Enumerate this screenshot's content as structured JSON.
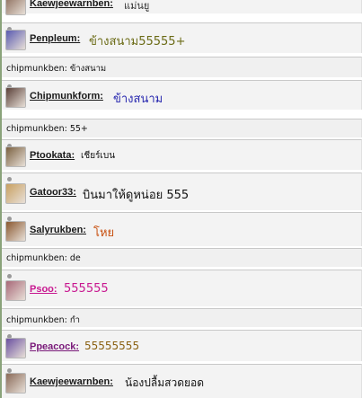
{
  "messages": [
    {
      "kind": "user",
      "user": "Kaewjeewarnben:",
      "text": "แม่นยู",
      "text_color": "#333333",
      "name_color": "#1a1a1a",
      "avatar": "photo-avatar-icon",
      "avatar_color": "#8a6a58"
    },
    {
      "kind": "user",
      "user": "Penpleum:",
      "text": "ข้างสนาม55555+",
      "text_color": "#6b6b16",
      "name_color": "#1a1a1a",
      "avatar": "cartoon-avatar-icon",
      "avatar_color": "#5a5ab0"
    },
    {
      "kind": "system",
      "text": "chipmunkben: ข้างสนาม"
    },
    {
      "kind": "user",
      "user": "Chipmunkform:",
      "text": "ข้างสนาม",
      "text_color": "#2a2ab0",
      "name_color": "#1a1a1a",
      "avatar": "photo-avatar-icon",
      "avatar_color": "#5a4038"
    },
    {
      "kind": "system",
      "text": "chipmunkben: 55+"
    },
    {
      "kind": "user",
      "user": "Ptookata:",
      "text": "เชียร์เบน",
      "text_color": "#111111",
      "name_color": "#1a1a1a",
      "avatar": "photo-avatar-icon",
      "avatar_color": "#7a6040"
    },
    {
      "kind": "user",
      "user": "Gatoor33:",
      "text": "บินมาให้ดูหน่อย 555",
      "text_color": "#111111",
      "name_color": "#1a1a1a",
      "avatar": "photo-avatar-icon",
      "avatar_color": "#c8a060"
    },
    {
      "kind": "user",
      "user": "Salyrukben:",
      "text": "โหย",
      "text_color": "#c85010",
      "name_color": "#1a1a1a",
      "avatar": "photo-avatar-icon",
      "avatar_color": "#8a5830"
    },
    {
      "kind": "system",
      "text": "chipmunkben: de"
    },
    {
      "kind": "user",
      "user": "Psoo:",
      "text": "555555",
      "text_color": "#c81890",
      "name_color": "#c81890",
      "avatar": "photo-avatar-icon",
      "avatar_color": "#a86878"
    },
    {
      "kind": "system",
      "text": "chipmunkben: กำ"
    },
    {
      "kind": "user",
      "user": "Ppeacock:",
      "text": "55555555",
      "text_color": "#8a6010",
      "name_color": "#7a1a7a",
      "avatar": "cartoon-avatar-icon",
      "avatar_color": "#6a50a0"
    },
    {
      "kind": "user",
      "user": "Kaewjeewarnben:",
      "text": "น้องปลื้มสวดยอด",
      "text_color": "#111111",
      "name_color": "#1a1a1a",
      "avatar": "photo-avatar-icon",
      "avatar_color": "#8a6a58"
    }
  ]
}
